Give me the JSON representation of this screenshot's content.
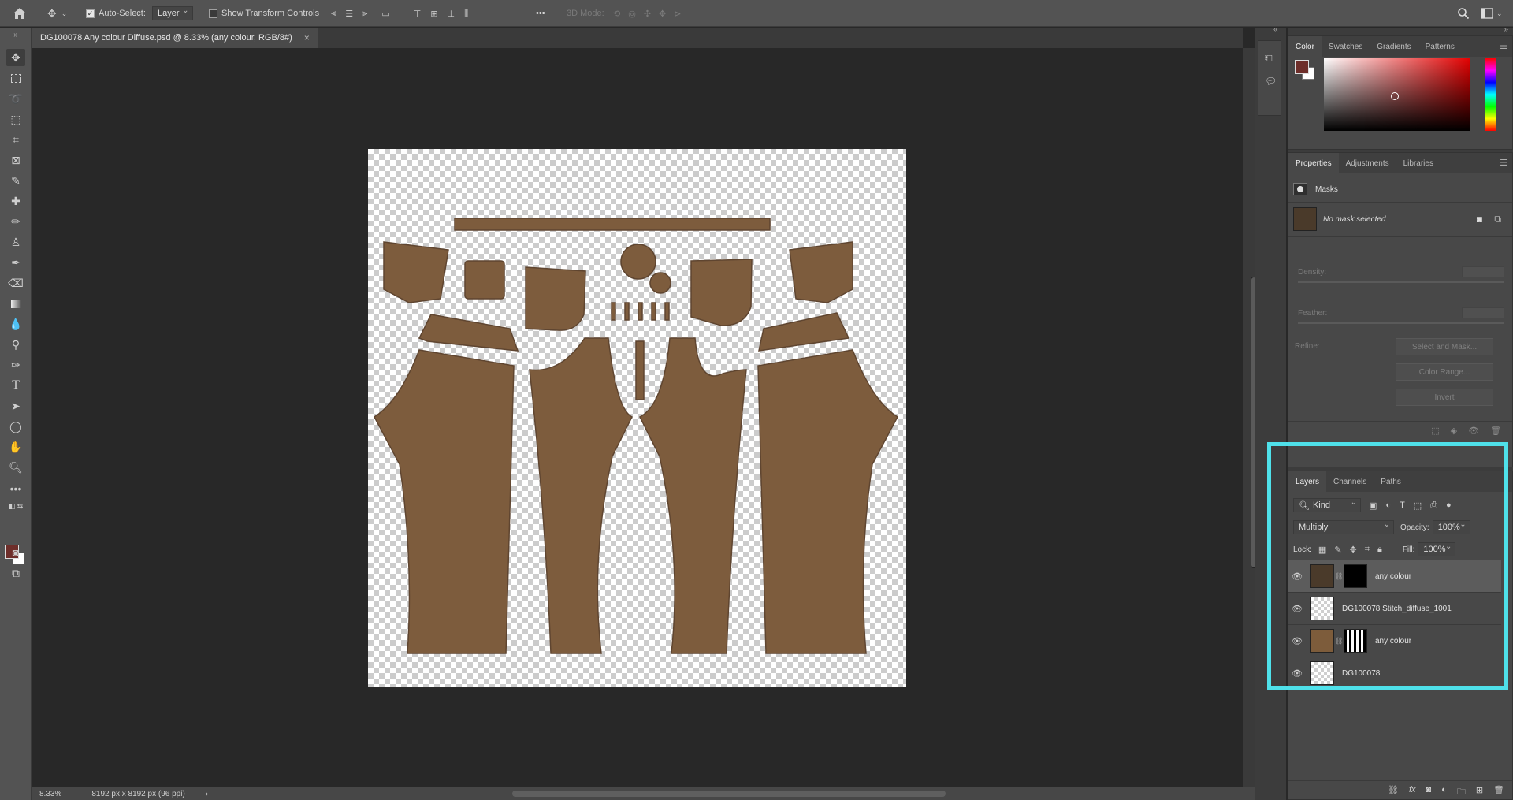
{
  "options_bar": {
    "auto_select_label": "Auto-Select:",
    "auto_select_checked": true,
    "auto_select_target": "Layer",
    "transform_controls_label": "Show Transform Controls",
    "transform_controls_checked": false,
    "more_label": "•••",
    "mode_3d_label": "3D Mode:"
  },
  "document": {
    "tab_title": "DG100078 Any colour Diffuse.psd @ 8.33% (any colour, RGB/8#)",
    "close_label": "×"
  },
  "status_bar": {
    "zoom": "8.33%",
    "doc_size": "8192 px x 8192 px (96 ppi)",
    "arrow": "›"
  },
  "color_panel": {
    "tabs": [
      "Color",
      "Swatches",
      "Gradients",
      "Patterns"
    ],
    "active_tab": "Color",
    "foreground_color": "#6e2e2a",
    "background_color": "#ffffff"
  },
  "properties_panel": {
    "tabs": [
      "Properties",
      "Adjustments",
      "Libraries"
    ],
    "section_label": "Masks",
    "mask_status": "No mask selected",
    "density_label": "Density:",
    "feather_label": "Feather:",
    "refine_label": "Refine:",
    "buttons": [
      "Select and Mask...",
      "Color Range...",
      "Invert"
    ]
  },
  "layers_panel": {
    "tabs": [
      "Layers",
      "Channels",
      "Paths"
    ],
    "filter_kind": "Kind",
    "blend_mode": "Multiply",
    "opacity_label": "Opacity:",
    "opacity_value": "100%",
    "lock_label": "Lock:",
    "fill_label": "Fill:",
    "fill_value": "100%",
    "layers": [
      {
        "name": "any colour",
        "selected": true,
        "thumb_color": "#4a3a2a",
        "has_mask": true,
        "mask_type": "black"
      },
      {
        "name": "DG100078 Stitch_diffuse_1001",
        "selected": false,
        "thumb_color": "checker",
        "has_mask": false
      },
      {
        "name": "any colour",
        "selected": false,
        "thumb_color": "#7d5c3b",
        "has_mask": true,
        "mask_type": "pattern"
      },
      {
        "name": "DG100078",
        "selected": false,
        "thumb_color": "checker",
        "has_mask": false
      }
    ]
  },
  "colors": {
    "fabric": "#7d5c3d",
    "fabric_edge": "#5f4530",
    "highlight": "#4fe1ea"
  }
}
